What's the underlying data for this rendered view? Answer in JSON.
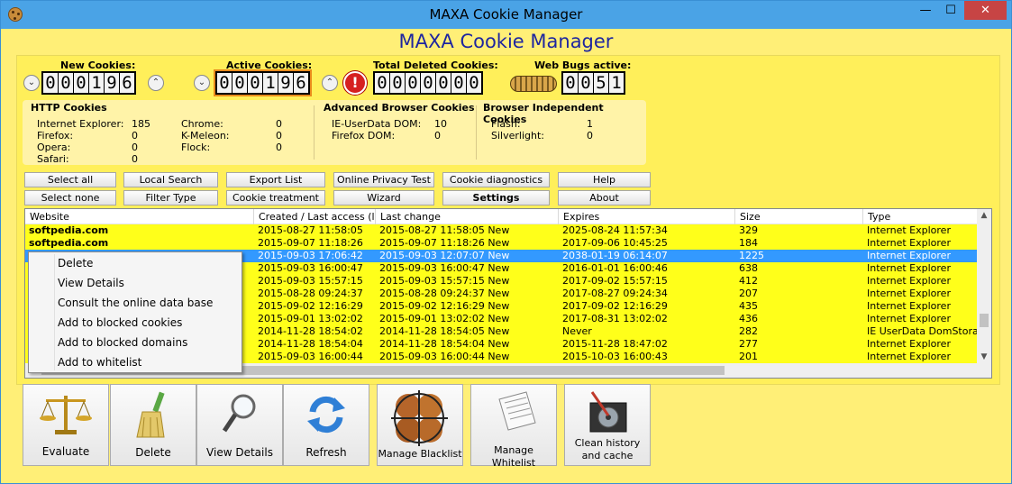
{
  "window": {
    "title": "MAXA Cookie Manager",
    "heading": "MAXA Cookie Manager",
    "controls": {
      "minimize": "—",
      "maximize": "☐",
      "close": "✕"
    }
  },
  "counters": {
    "new_cookies": {
      "label": "New Cookies:",
      "digits": [
        "0",
        "0",
        "0",
        "1",
        "9",
        "6"
      ]
    },
    "active_cookies": {
      "label": "Active Cookies:",
      "digits": [
        "0",
        "0",
        "0",
        "1",
        "9",
        "6"
      ]
    },
    "total_deleted": {
      "label": "Total Deleted Cookies:",
      "digits": [
        "0",
        "0",
        "0",
        "0",
        "0",
        "0",
        "0"
      ]
    },
    "web_bugs": {
      "label": "Web Bugs active:",
      "digits": [
        "0",
        "0",
        "5",
        "1"
      ]
    },
    "arrow_down": "⌄",
    "arrow_up": "⌃",
    "alert": "!"
  },
  "stats": {
    "http": {
      "title": "HTTP Cookies",
      "items": [
        {
          "name": "Internet Explorer:",
          "value": "185"
        },
        {
          "name": "Firefox:",
          "value": "0"
        },
        {
          "name": "Opera:",
          "value": "0"
        },
        {
          "name": "Safari:",
          "value": "0"
        },
        {
          "name": "Chrome:",
          "value": "0"
        },
        {
          "name": "K-Meleon:",
          "value": "0"
        },
        {
          "name": "Flock:",
          "value": "0"
        }
      ]
    },
    "advanced": {
      "title": "Advanced Browser Cookies",
      "items": [
        {
          "name": "IE-UserData DOM:",
          "value": "10"
        },
        {
          "name": "Firefox DOM:",
          "value": "0"
        }
      ]
    },
    "independent": {
      "title": "Browser Independent Cookies",
      "items": [
        {
          "name": "Flash:",
          "value": "1"
        },
        {
          "name": "Silverlight:",
          "value": "0"
        }
      ]
    }
  },
  "buttons": {
    "select_all": "Select all",
    "select_none": "Select none",
    "local_search": "Local Search",
    "filter_type": "Filter Type",
    "export_list": "Export List",
    "cookie_treatment": "Cookie treatment",
    "online_privacy_test": "Online Privacy Test",
    "wizard": "Wizard",
    "cookie_diagnostics": "Cookie diagnostics",
    "settings": "Settings",
    "help": "Help",
    "about": "About"
  },
  "table": {
    "columns": [
      "Website",
      "Created / Last access (l...",
      "Last change",
      "Expires",
      "Size",
      "Type"
    ],
    "rows": [
      {
        "site": "softpedia.com",
        "created": "2015-08-27 11:58:05",
        "change": "2015-08-27 11:58:05 New",
        "expires": "2025-08-24 11:57:34",
        "size": "329",
        "type": "Internet Explorer"
      },
      {
        "site": "softpedia.com",
        "created": "2015-09-07 11:18:26",
        "change": "2015-09-07 11:18:26 New",
        "expires": "2017-09-06 10:45:25",
        "size": "184",
        "type": "Internet Explorer"
      },
      {
        "site": "",
        "created": "2015-09-03 17:06:42",
        "change": "2015-09-03 12:07:07 New",
        "expires": "2038-01-19 06:14:07",
        "size": "1225",
        "type": "Internet Explorer"
      },
      {
        "site": "",
        "created": "2015-09-03 16:00:47",
        "change": "2015-09-03 16:00:47 New",
        "expires": "2016-01-01 16:00:46",
        "size": "638",
        "type": "Internet Explorer"
      },
      {
        "site": "",
        "created": "2015-09-03 15:57:15",
        "change": "2015-09-03 15:57:15 New",
        "expires": "2017-09-02 15:57:15",
        "size": "412",
        "type": "Internet Explorer"
      },
      {
        "site": "",
        "created": "2015-08-28 09:24:37",
        "change": "2015-08-28 09:24:37 New",
        "expires": "2017-08-27 09:24:34",
        "size": "207",
        "type": "Internet Explorer"
      },
      {
        "site": "",
        "created": "2015-09-02 12:16:29",
        "change": "2015-09-02 12:16:29 New",
        "expires": "2017-09-02 12:16:29",
        "size": "435",
        "type": "Internet Explorer"
      },
      {
        "site": "",
        "created": "2015-09-01 13:02:02",
        "change": "2015-09-01 13:02:02 New",
        "expires": "2017-08-31 13:02:02",
        "size": "436",
        "type": "Internet Explorer"
      },
      {
        "site": "",
        "created": "2014-11-28 18:54:02",
        "change": "2014-11-28 18:54:05 New",
        "expires": "Never",
        "size": "282",
        "type": "IE UserData DomStorage"
      },
      {
        "site": "",
        "created": "2014-11-28 18:54:04",
        "change": "2014-11-28 18:54:04 New",
        "expires": "2015-11-28 18:47:02",
        "size": "277",
        "type": "Internet Explorer"
      },
      {
        "site": "",
        "created": "2015-09-03 16:00:44",
        "change": "2015-09-03 16:00:44 New",
        "expires": "2015-10-03 16:00:43",
        "size": "201",
        "type": "Internet Explorer"
      }
    ],
    "selected_row": 2
  },
  "context_menu": {
    "items": [
      "Delete",
      "View Details",
      "Consult the online data base",
      "Add to blocked cookies",
      "Add to blocked domains",
      "Add to whitelist"
    ]
  },
  "toolbar": {
    "evaluate": "Evaluate",
    "delete": "Delete",
    "view_details": "View Details",
    "refresh": "Refresh",
    "manage_blacklist": "Manage Blacklist",
    "manage_whitelist": "Manage Whitelist",
    "clean_history": "Clean history and cache"
  },
  "colors": {
    "background": "#ffef77",
    "row_highlight": "#ffff1a",
    "selection": "#3399ff",
    "heading": "#1e26a0",
    "titlebar": "#4aa3e6"
  }
}
